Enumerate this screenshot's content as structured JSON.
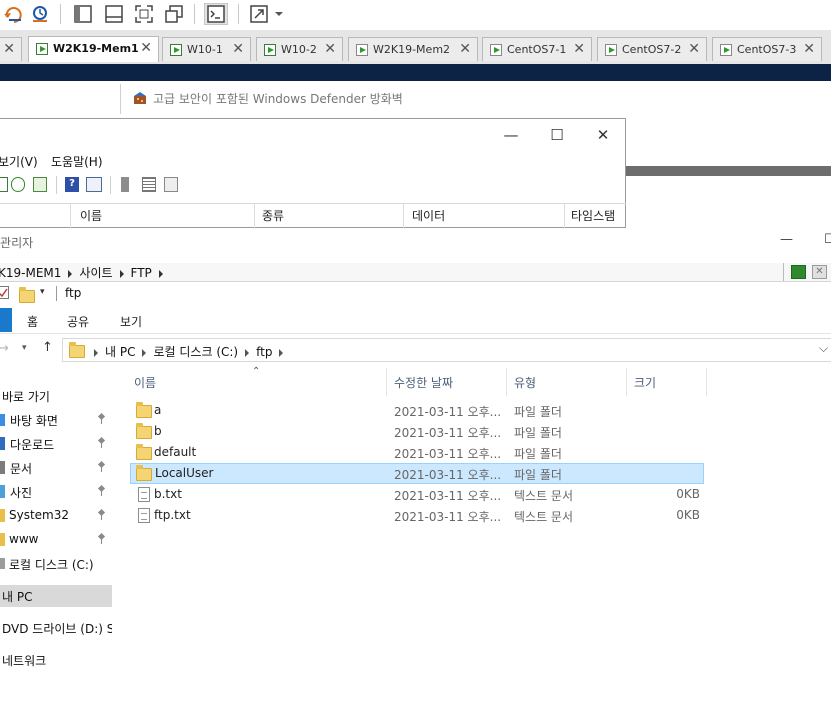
{
  "vm_tabs": [
    {
      "label": "W2K19-Mem1",
      "active": true
    },
    {
      "label": "W10-1",
      "active": false
    },
    {
      "label": "W10-2",
      "active": false
    },
    {
      "label": "W2K19-Mem2",
      "active": false
    },
    {
      "label": "CentOS7-1",
      "active": false
    },
    {
      "label": "CentOS7-2",
      "active": false
    },
    {
      "label": "CentOS7-3",
      "active": false
    }
  ],
  "defender": {
    "title": "고급 보안이 포함된 Windows Defender 방화벽"
  },
  "regedit": {
    "menu_view": "보기(V)",
    "menu_help": "도움말(H)",
    "columns": {
      "name": "이름",
      "type": "종류",
      "data": "데이터",
      "timestamp": "타임스탬프"
    }
  },
  "iis": {
    "title_fragment": "\\관리자",
    "breadcrumb": [
      "K19-MEM1",
      "사이트",
      "FTP"
    ]
  },
  "explorer": {
    "qat_title": "ftp",
    "ribbon_tabs": [
      "홈",
      "공유",
      "보기"
    ],
    "address": [
      "내 PC",
      "로컬 디스크 (C:)",
      "ftp"
    ],
    "columns": {
      "name": "이름",
      "date": "수정한 날짜",
      "type": "유형",
      "size": "크기"
    },
    "nav": {
      "quick_access": "바로 가기",
      "items": [
        {
          "label": "바탕 화면",
          "pinned": true
        },
        {
          "label": "다운로드",
          "pinned": true
        },
        {
          "label": "문서",
          "pinned": true
        },
        {
          "label": "사진",
          "pinned": true
        },
        {
          "label": "System32",
          "pinned": true
        },
        {
          "label": "www",
          "pinned": true
        }
      ],
      "local_disk": "로컬 디스크 (C:)",
      "this_pc": "내 PC",
      "dvd": "DVD 드라이브 (D:) S",
      "network": "네트워크"
    },
    "files": [
      {
        "name": "a",
        "date": "2021-03-11 오후...",
        "type": "파일 폴더",
        "size": "",
        "kind": "folder"
      },
      {
        "name": "b",
        "date": "2021-03-11 오후...",
        "type": "파일 폴더",
        "size": "",
        "kind": "folder"
      },
      {
        "name": "default",
        "date": "2021-03-11 오후...",
        "type": "파일 폴더",
        "size": "",
        "kind": "folder"
      },
      {
        "name": "LocalUser",
        "date": "2021-03-11 오후...",
        "type": "파일 폴더",
        "size": "",
        "kind": "folder",
        "selected": true
      },
      {
        "name": "b.txt",
        "date": "2021-03-11 오후...",
        "type": "텍스트 문서",
        "size": "0KB",
        "kind": "file"
      },
      {
        "name": "ftp.txt",
        "date": "2021-03-11 오후...",
        "type": "텍스트 문서",
        "size": "0KB",
        "kind": "file"
      }
    ]
  }
}
